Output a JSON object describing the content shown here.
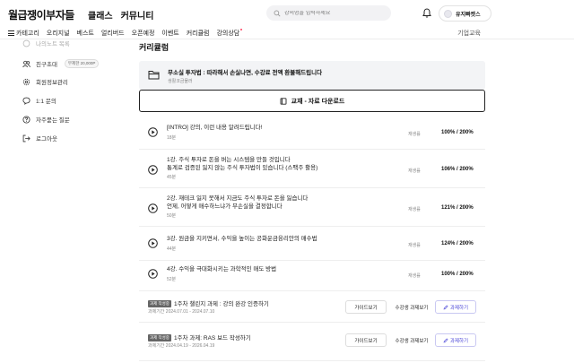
{
  "header": {
    "logo": "월급쟁이부자들",
    "nav": [
      "클래스",
      "커뮤니티"
    ],
    "search_placeholder": "강의명을 입력하세요",
    "username": "유지빠켓스"
  },
  "subnav": {
    "items": [
      "카테고리",
      "오리지널",
      "베스트",
      "얼리버드",
      "오픈예정",
      "이벤트",
      "커리큘럼",
      "강의상담"
    ],
    "right": "기업교육"
  },
  "sidebar": {
    "items": [
      {
        "label": "나의노트 목록",
        "faded": true
      },
      {
        "label": "친구초대",
        "badge": "무제한 20,000P"
      },
      {
        "label": "회원정보관리"
      },
      {
        "label": "1:1 문의"
      },
      {
        "label": "자주묻는 질문"
      },
      {
        "label": "로그아웃"
      }
    ]
  },
  "main": {
    "title": "커리큘럼",
    "notice": {
      "title": "무소실 투자법 : 따라해서 손실나면, 수강료 전액 환불해드립니다",
      "sub": "생활코금물러"
    },
    "download_label": "교재 - 자료 다운로드",
    "replay_label": "재생률",
    "lectures": [
      {
        "lines": [
          "[INTRO] 강의, 이런 내용 알려드립니다!"
        ],
        "duration": "18분",
        "progress": "100% / 200%"
      },
      {
        "lines": [
          "1강. 주식 투자로 돈을 버는 시스템을 만들 것입니다",
          "통계로 검증된 잃지 않는 주식 투자법이 있습니다 (스팩주 활용)"
        ],
        "duration": "45분",
        "progress": "106% / 200%"
      },
      {
        "lines": [
          "2강. 재테크 잃지 못해서 지금도 주식 투자로 돈을 잃습니다",
          "언제, 어떻게 매수하느냐가 무손실을 결정합니다"
        ],
        "duration": "50분",
        "progress": "121% / 200%"
      },
      {
        "lines": [
          "3강. 원금을 지키면서, 수익을 높이는 공화운금융리안의 매수법"
        ],
        "duration": "44분",
        "progress": "124% / 200%"
      },
      {
        "lines": [
          "4강. 수익을 극대화시키는 과학적인 매도 방법"
        ],
        "duration": "52분",
        "progress": "100% / 200%"
      }
    ],
    "assignments": [
      {
        "badge": "과제 작성중",
        "title": "1주차 챌린지 과제 : 강의 완강 인증하기",
        "date": "과제기간 2024.07.01 - 2024.07.10"
      },
      {
        "badge": "과제 작성중",
        "title": "1주차 과제: RAS 보드 작성하기",
        "date": "과제기간 2024.04.19 - 2026.04.19"
      }
    ],
    "guide_label": "가이드보기",
    "peer_label": "수강생 과제보기",
    "submit_label": "과제하기"
  }
}
